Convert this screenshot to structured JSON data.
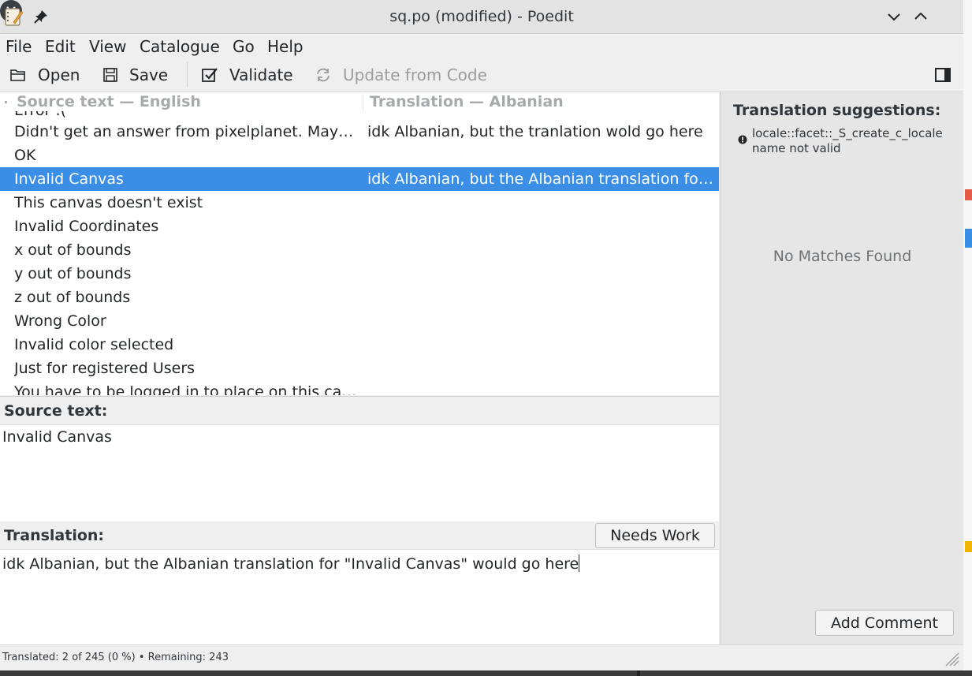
{
  "window": {
    "title": "sq.po (modified) - Poedit"
  },
  "menu": [
    "File",
    "Edit",
    "View",
    "Catalogue",
    "Go",
    "Help"
  ],
  "toolbar": {
    "open_label": "Open",
    "save_label": "Save",
    "validate_label": "Validate",
    "update_label": "Update from Code"
  },
  "list": {
    "header_source": "Source text — English",
    "header_translation": "Translation — Albanian",
    "partial_top": "Error :(",
    "rows": [
      {
        "source": "Didn't get an answer from pixelplanet. Maybe try later.",
        "translation": "idk Albanian, but the tranlation wold go here",
        "selected": false
      },
      {
        "source": "OK",
        "translation": "",
        "selected": false
      },
      {
        "source": "Invalid Canvas",
        "translation": "idk Albanian, but the Albanian translation for \"Invalid Canvas\" would go here",
        "selected": true
      },
      {
        "source": "This canvas doesn't exist",
        "translation": "",
        "selected": false
      },
      {
        "source": "Invalid Coordinates",
        "translation": "",
        "selected": false
      },
      {
        "source": "x out of bounds",
        "translation": "",
        "selected": false
      },
      {
        "source": "y out of bounds",
        "translation": "",
        "selected": false
      },
      {
        "source": "z out of bounds",
        "translation": "",
        "selected": false
      },
      {
        "source": "Wrong Color",
        "translation": "",
        "selected": false
      },
      {
        "source": "Invalid color selected",
        "translation": "",
        "selected": false
      },
      {
        "source": "Just for registered Users",
        "translation": "",
        "selected": false
      },
      {
        "source": "You have to be logged in to place on this canvas",
        "translation": "",
        "selected": false
      }
    ]
  },
  "source_pane": {
    "label": "Source text:",
    "text": "Invalid Canvas"
  },
  "translation_pane": {
    "label": "Translation:",
    "needs_work_label": "Needs Work",
    "text": "idk Albanian, but the Albanian translation for \"Invalid Canvas\" would go here"
  },
  "sidebar": {
    "title": "Translation suggestions:",
    "error_line1": "locale::facet::_S_create_c_locale",
    "error_line2": "name not valid",
    "no_matches": "No Matches Found",
    "add_comment_label": "Add Comment"
  },
  "statusbar": {
    "text": "Translated: 2 of 245 (0 %)  •  Remaining: 243"
  },
  "colors": {
    "selection": "#3a8ee6",
    "window_bg": "#efefef",
    "sidebar_bg": "#e6e6e6"
  }
}
